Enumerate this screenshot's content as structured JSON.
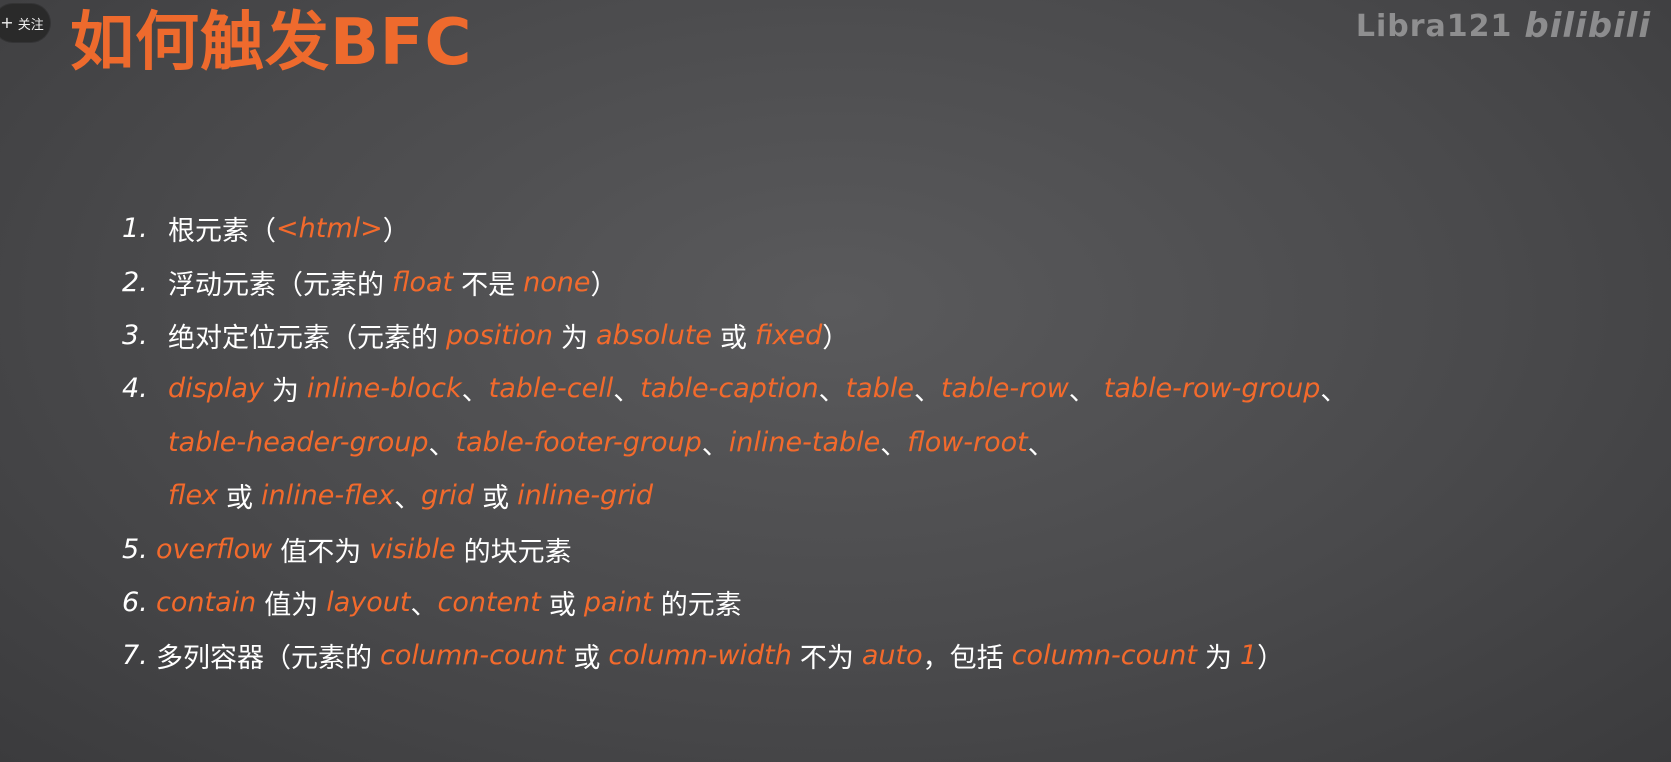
{
  "follow_button": {
    "label": "关注"
  },
  "watermark": {
    "uploader": "Libra121",
    "logo": "bilibili"
  },
  "slide": {
    "title": "如何触发BFC",
    "items": [
      {
        "num": "1.",
        "parts": [
          "根元素（",
          "<html>",
          "）"
        ]
      },
      {
        "num": "2.",
        "parts": [
          "浮动元素（元素的",
          "float",
          "不是",
          "none",
          "）"
        ]
      },
      {
        "num": "3.",
        "parts": [
          "绝对定位元素（元素的",
          "position",
          "为",
          "absolute",
          "或",
          "fixed",
          "）"
        ]
      },
      {
        "num": "4.",
        "parts": [
          "display",
          "为",
          "inline-block",
          "、",
          "table-cell",
          "、",
          "table-caption",
          "、",
          "table",
          "、",
          "table-row",
          "、",
          "table-row-group",
          "、"
        ]
      },
      {
        "parts": [
          "table-header-group",
          "、",
          "table-footer-group",
          "、",
          "inline-table",
          "、",
          "flow-root",
          "、"
        ]
      },
      {
        "parts": [
          "flex",
          "或",
          "inline-flex",
          "、",
          "grid",
          "或",
          "inline-grid"
        ]
      },
      {
        "num": "5.",
        "parts": [
          "overflow",
          "值不为",
          "visible",
          "的块元素"
        ]
      },
      {
        "num": "6.",
        "parts": [
          "contain",
          "值为",
          "layout",
          "、",
          "content",
          "或",
          "paint",
          "的元素"
        ]
      },
      {
        "num": "7.",
        "parts": [
          "多列容器（元素的",
          "column-count",
          "或",
          "column-width",
          "不为",
          "auto",
          "，包括",
          "column-count",
          "为",
          "1",
          "）"
        ]
      }
    ]
  }
}
